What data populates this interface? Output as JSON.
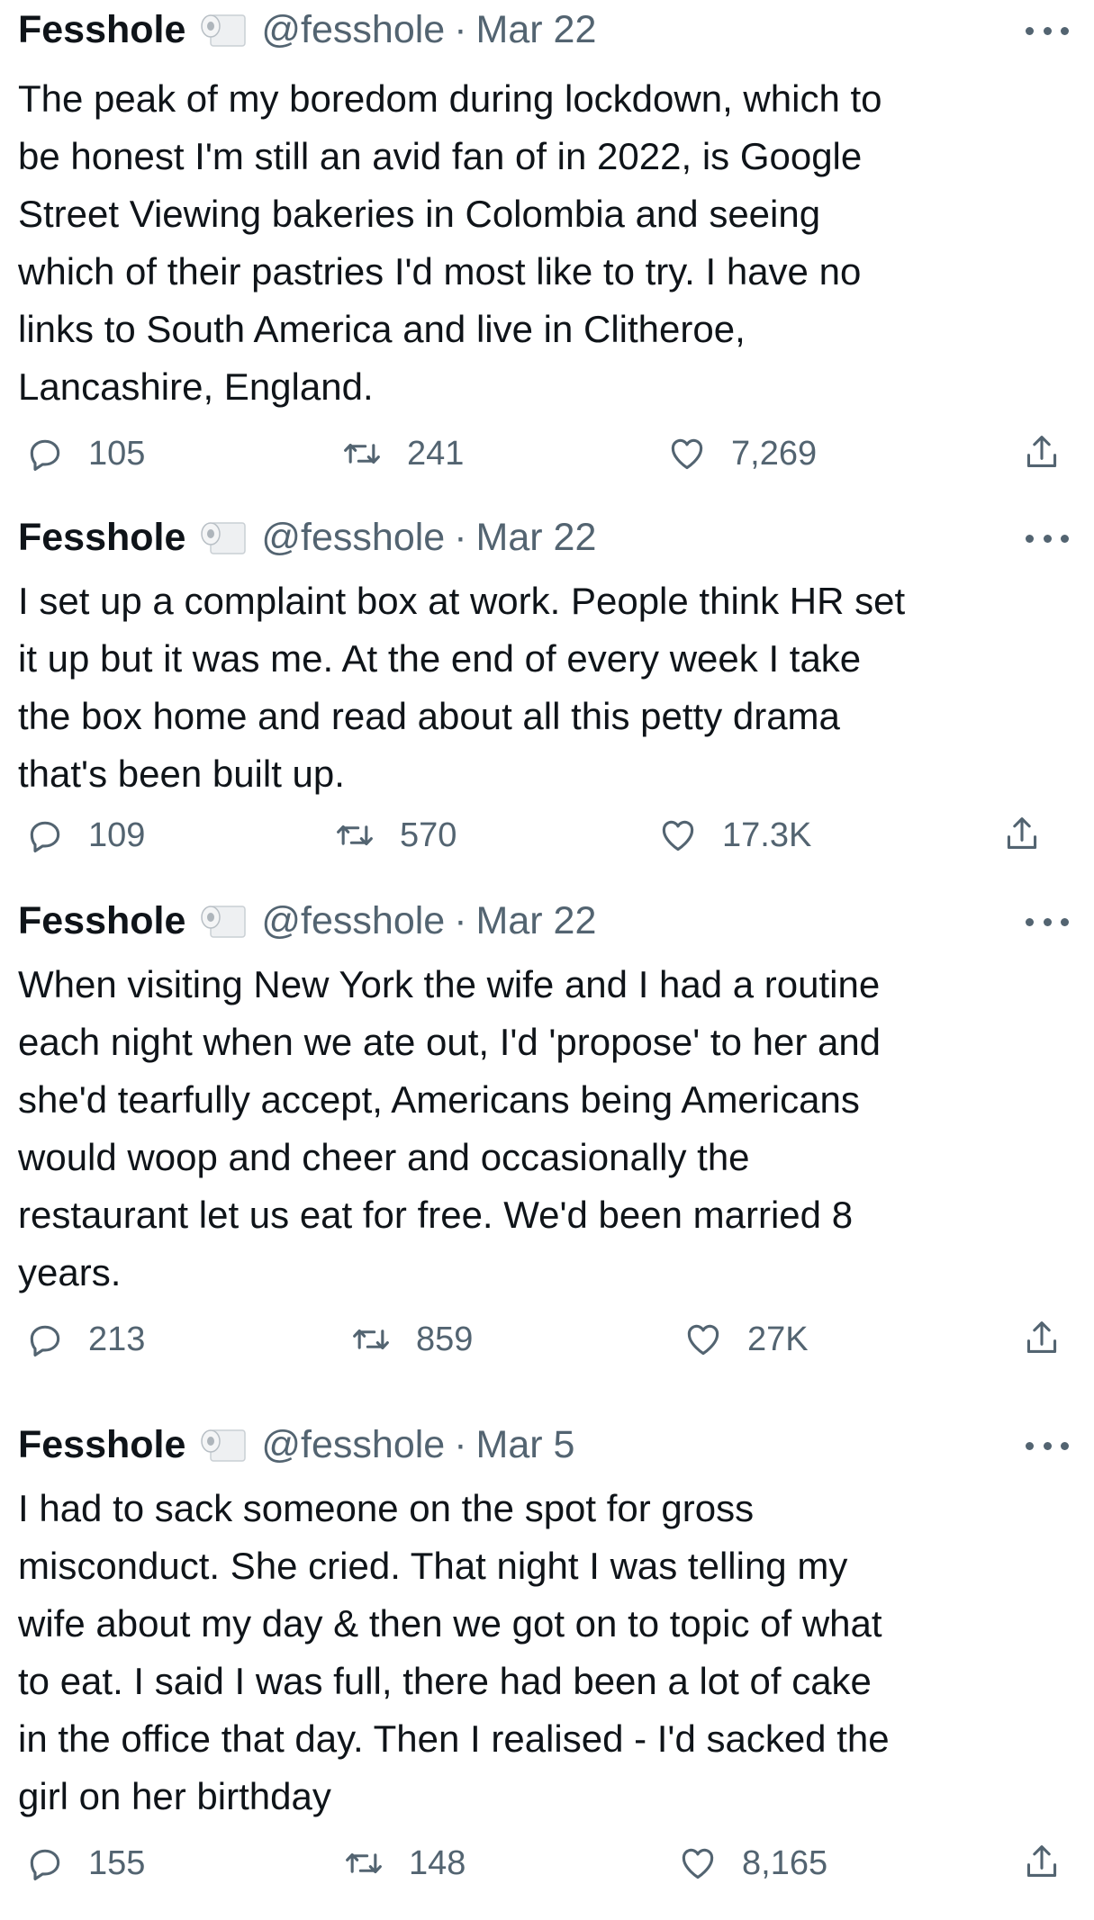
{
  "tweets": [
    {
      "name": "Fesshole",
      "handle": "@fesshole",
      "separator": "·",
      "date": "Mar 22",
      "lines": [
        "The peak of my boredom during lockdown, which to",
        "be honest I'm still an avid fan of in 2022, is Google",
        "Street Viewing bakeries in Colombia and seeing",
        "which of their pastries I'd most like to try. I have no",
        "links to South America and live in Clitheroe,",
        "Lancashire, England."
      ],
      "replies": "105",
      "retweets": "241",
      "likes": "7,269"
    },
    {
      "name": "Fesshole",
      "handle": "@fesshole",
      "separator": "·",
      "date": "Mar 22",
      "lines": [
        "I set up a complaint box at work. People think HR set",
        "it up but it was me. At the end of every week I take",
        "the box home and read about all this petty drama",
        "that's been built up."
      ],
      "replies": "109",
      "retweets": "570",
      "likes": "17.3K"
    },
    {
      "name": "Fesshole",
      "handle": "@fesshole",
      "separator": "·",
      "date": "Mar 22",
      "lines": [
        "When visiting New York the wife and I had a routine",
        "each night when we ate out, I'd 'propose' to her and",
        "she'd tearfully accept, Americans being Americans",
        "would woop and cheer and occasionally the",
        "restaurant let us eat for free. We'd been married 8",
        "years."
      ],
      "replies": "213",
      "retweets": "859",
      "likes": "27K"
    },
    {
      "name": "Fesshole",
      "handle": "@fesshole",
      "separator": "·",
      "date": "Mar 5",
      "lines": [
        "I had to sack someone on the spot for gross",
        "misconduct. She cried. That night I was telling my",
        "wife about my day & then we got on to topic of what",
        "to eat. I said I was full, there had been a lot of cake",
        "in the office that day. Then I realised - I'd sacked the",
        "girl on her birthday"
      ],
      "replies": "155",
      "retweets": "148",
      "likes": "8,165"
    }
  ],
  "icons": {
    "avatar": "toilet-roll-icon",
    "reply": "reply-icon",
    "retweet": "retweet-icon",
    "like": "heart-icon",
    "share": "share-icon",
    "more": "more-icon"
  },
  "colors": {
    "text": "#0f1419",
    "secondary": "#536471",
    "background": "#ffffff"
  }
}
